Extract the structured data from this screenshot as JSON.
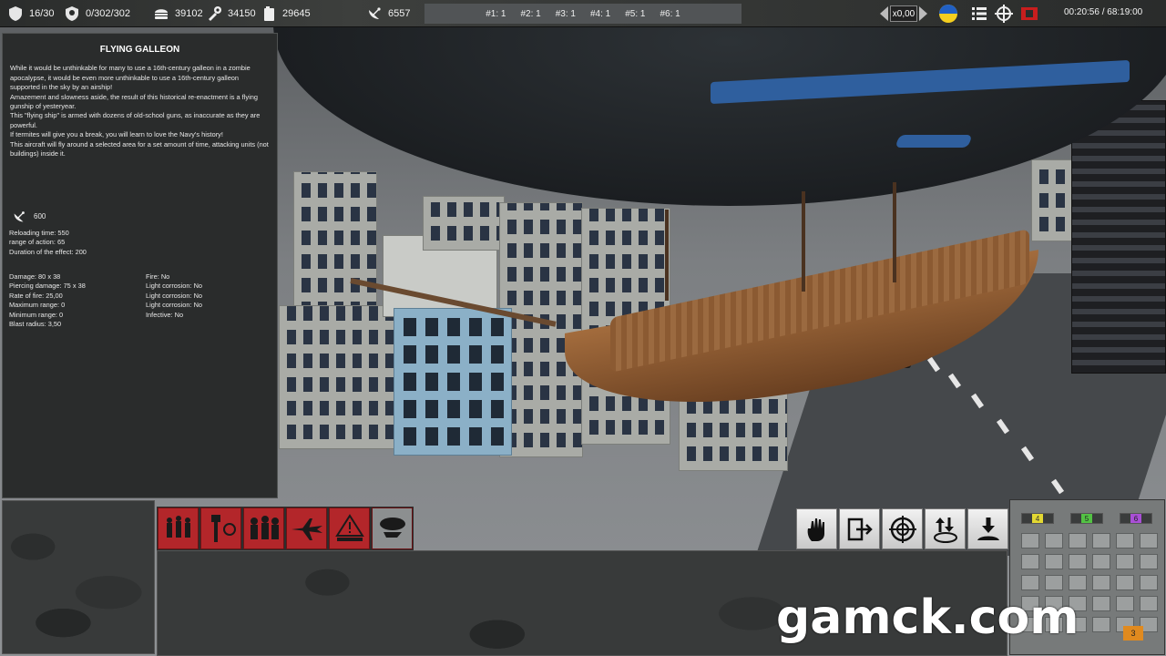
{
  "hud": {
    "units": "16/30",
    "population": "0/302/302",
    "food": "39102",
    "material": "34150",
    "fuel": "29645",
    "satellite": "6557",
    "squads": [
      "#1: 1",
      "#2: 1",
      "#3: 1",
      "#4: 1",
      "#5: 1",
      "#6: 1"
    ],
    "speed": "x0,00",
    "timer": "00:20:56 / 68:19:00"
  },
  "info": {
    "title": "FLYING GALLEON",
    "description": "While it would be unthinkable for many to use a 16th-century galleon in a zombie apocalypse, it would be even more unthinkable to use a 16th-century galleon supported in the sky by an airship!\nAmazement and slowness aside, the result of this historical re-enactment is a flying gunship of yesteryear.\nThis \"flying ship\" is armed with dozens of old-school guns, as inaccurate as they are powerful.\nIf termites will give you a break, you will learn to love the Navy's history!\nThis aircraft will fly around a selected area for a set amount of time, attacking units (not buildings) inside it.",
    "cost": "600",
    "reload_lines": [
      "Reloading time: 550",
      "range of action: 65",
      "Duration of the effect: 200"
    ],
    "stats_left": [
      "Damage: 80 x 38",
      "Piercing damage: 75 x 38",
      "Rate of fire: 25,00",
      "Maximum range: 0",
      "Minimum range: 0",
      "Blast radius: 3,50"
    ],
    "stats_right": [
      "Fire: No",
      "Light corrosion: No",
      "Light corrosion: No",
      "Light corrosion: No",
      "Infective: No"
    ]
  },
  "grid": {
    "groups": [
      "4",
      "5",
      "6"
    ],
    "marker": "3"
  },
  "watermark": "gamck.com",
  "colors": {
    "card_red": "#b3262a",
    "hud_bg": "#2a2c2b",
    "group_4": "#e3d832",
    "group_5": "#53c244",
    "group_6": "#a94fd6",
    "blimp_band": "#2f5f9e"
  }
}
